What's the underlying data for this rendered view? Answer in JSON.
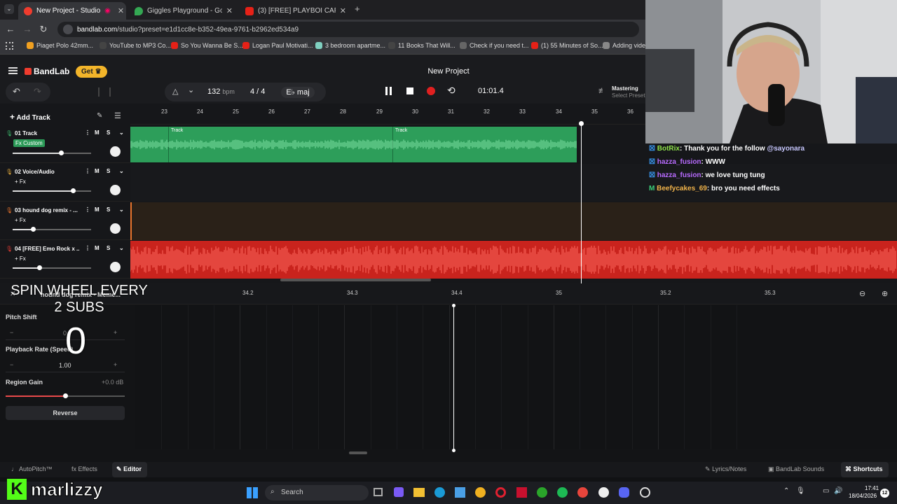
{
  "browser": {
    "tabs": [
      {
        "title": "New Project - Studio",
        "active": true
      },
      {
        "title": "Giggles Playground - Google M",
        "active": false
      },
      {
        "title": "(3) [FREE] PLAYBOI CARTI X KEN",
        "active": false
      }
    ],
    "url_domain": "bandlab.com",
    "url_path": "/studio?preset=e1d1cc8e-b352-49ea-9761-b2962ed534a9",
    "bookmarks": [
      "Piaget Polo 42mm...",
      "YouTube to MP3 Co...",
      "So You Wanna Be S...",
      "Logan Paul Motivati...",
      "3 bedroom apartme...",
      "11 Books That Will...",
      "Check if you need t...",
      "(1) 55 Minutes of So...",
      "Adding video"
    ]
  },
  "header": {
    "brand": "BandLab",
    "get_label": "Get",
    "project_title": "New Project",
    "bpm_value": "132",
    "bpm_unit": "bpm",
    "time_sig": "4 / 4",
    "key": "E♭ maj",
    "time": "01:01.4",
    "mastering_label": "Mastering",
    "mastering_sub": "Select Preset"
  },
  "tracks_panel": {
    "add_track_label": "Add Track",
    "ruler": [
      "23",
      "24",
      "25",
      "26",
      "27",
      "28",
      "29",
      "30",
      "31",
      "32",
      "33",
      "34",
      "35",
      "36"
    ],
    "tracks": [
      {
        "name": "01  Track",
        "fx": "Fx Custom",
        "volume": 0.62,
        "color": "#3ab86a",
        "clip_label": "Track"
      },
      {
        "name": "02  Voice/Audio",
        "fx": "+ Fx",
        "volume": 0.77,
        "color": "#e2a93b"
      },
      {
        "name": "03  hound dog remix - ...",
        "fx": "+ Fx",
        "volume": 0.26,
        "color": "#e8742c"
      },
      {
        "name": "04  [FREE] Emo Rock x ...",
        "fx": "+ Fx",
        "volume": 0.34,
        "color": "#e23a32"
      }
    ],
    "mute_label": "M",
    "solo_label": "S"
  },
  "editor": {
    "region_title": "hound dog remix - Meme...",
    "ruler": [
      "34.2",
      "34.3",
      "34.4",
      "35",
      "35.2",
      "35.3"
    ],
    "pitch_shift_label": "Pitch Shift",
    "pitch_value": "0",
    "playback_label": "Playback Rate (Speed)",
    "playback_value": "1.00",
    "gain_label": "Region Gain",
    "gain_value": "+0.0 dB",
    "gain_level": 0.5,
    "reverse_label": "Reverse"
  },
  "bottom_bar": {
    "autopitch": "AutoPitch™",
    "effects": "Effects",
    "editor": "Editor",
    "lyrics": "Lyrics/Notes",
    "sounds": "BandLab Sounds",
    "shortcuts": "Shortcuts"
  },
  "chat": [
    {
      "user": "BotRix",
      "user_color": "#8fe34a",
      "text": ": Thank you for the follow ",
      "mention": "@sayonara"
    },
    {
      "user": "hazza_fusion",
      "user_color": "#b86bff",
      "text": ": WWW",
      "mention": ""
    },
    {
      "user": "hazza_fusion",
      "user_color": "#b86bff",
      "text": ": we love tung tung",
      "mention": ""
    },
    {
      "user": "Beefycakes_69",
      "user_color": "#f0b34a",
      "text": ": bro you need effects",
      "mention": ""
    }
  ],
  "overlay": {
    "spin_line1": "SPIN WHEEL EVERY",
    "spin_line2": "2 SUBS",
    "sub_count": "0",
    "watermark_k": "K",
    "watermark_name": "marlizzy"
  },
  "taskbar": {
    "search_label": "Search",
    "clock_time": "17:41",
    "clock_date": "18/04/2026",
    "notif_badge": "12"
  }
}
